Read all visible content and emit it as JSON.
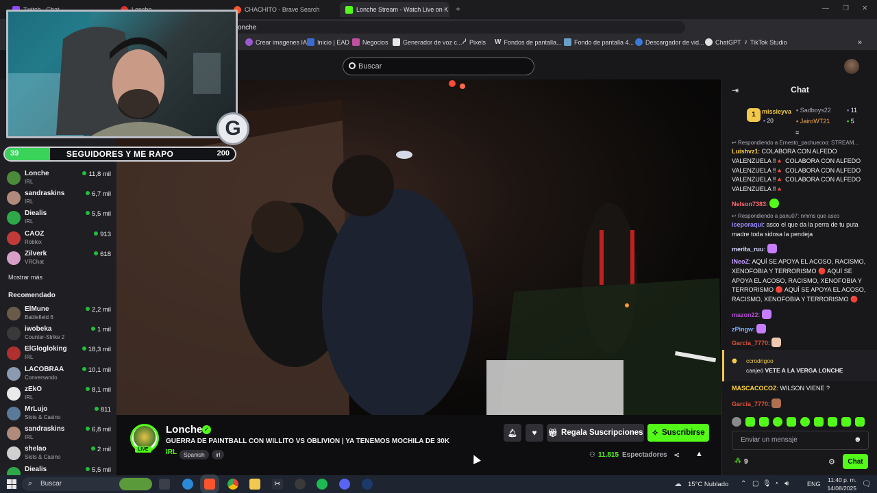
{
  "browser": {
    "tabs": [
      {
        "label": "Twitch · Chat"
      },
      {
        "label": "Lonche"
      },
      {
        "label": "CHACHITO - Brave Search"
      },
      {
        "label": "Lonche Stream - Watch Live on K"
      }
    ],
    "new_tab": "+",
    "url_text": "onche",
    "bookmarks": [
      {
        "label": "Crear imagenes IA"
      },
      {
        "label": "Inicio | EAD"
      },
      {
        "label": "Negocios"
      },
      {
        "label": "Generador de voz c..."
      },
      {
        "label": "Pixels"
      },
      {
        "label": "Fondos de pantalla..."
      },
      {
        "label": "Fondo de pantalla 4..."
      },
      {
        "label": "Descargador de vid..."
      },
      {
        "label": "ChatGPT"
      },
      {
        "label": "TikTok Studio"
      }
    ],
    "bookmarks_more": "»"
  },
  "site": {
    "search_placeholder": "Buscar"
  },
  "overlay": {
    "followers_current": "39",
    "followers_goal_text": "SEGUIDORES Y ME RAPO",
    "followers_target": "200",
    "followers_progress": 0.195,
    "logo_letter": "G"
  },
  "sidebar": {
    "followed": [
      {
        "name": "Lonche",
        "category": "IRL",
        "viewers": "11,8 mil",
        "color": "#4a8a3a",
        "live_color": "green"
      },
      {
        "name": "sandraskins",
        "category": "IRL",
        "viewers": "6,7 mil",
        "color": "#b08a7a",
        "live_color": "green"
      },
      {
        "name": "Diealis",
        "category": "IRL",
        "viewers": "5,5 mil",
        "color": "#2fa84a",
        "live_color": "green"
      },
      {
        "name": "CAOZ",
        "category": "Roblox",
        "viewers": "913",
        "color": "#c23a3a",
        "live_color": "green"
      },
      {
        "name": "Zilverk",
        "category": "VRChat",
        "viewers": "618",
        "color": "#d8a0c8",
        "live_color": "green"
      }
    ],
    "show_more": "Mostrar más",
    "recommended_title": "Recomendado",
    "recommended": [
      {
        "name": "ElMune",
        "category": "Battlefield 6",
        "viewers": "2,2 mil",
        "color": "#6a5a4a"
      },
      {
        "name": "iwobeka",
        "category": "Counter-Strike 2",
        "viewers": "1 mil",
        "color": "#3a3a3a"
      },
      {
        "name": "ElGlogloking",
        "category": "IRL",
        "viewers": "18,3 mil",
        "color": "#b03030"
      },
      {
        "name": "LACOBRAA",
        "category": "Conversando",
        "viewers": "10,1 mil",
        "color": "#8a9ab0"
      },
      {
        "name": "zEkO",
        "category": "IRL",
        "viewers": "8,1 mil",
        "color": "#eaeaea"
      },
      {
        "name": "MrLujo",
        "category": "Slots & Casino",
        "viewers": "811",
        "color": "#5a7a9a"
      },
      {
        "name": "sandraskins",
        "category": "IRL",
        "viewers": "6,8 mil",
        "color": "#b08a7a"
      },
      {
        "name": "shelao",
        "category": "Slots & Casino",
        "viewers": "2 mil",
        "color": "#d0d0d0"
      },
      {
        "name": "Diealis",
        "category": "IRL",
        "viewers": "5,5 mil",
        "color": "#2fa84a"
      }
    ]
  },
  "stream": {
    "channel": "Lonche",
    "live_label": "LIVE",
    "title": "GUERRA DE PAINTBALL CON WILLITO VS OBLIVION | YA TENEMOS MOCHILA DE 30K",
    "category": "IRL",
    "tags": [
      "Spanish",
      "irl"
    ],
    "gift_button": "Regala Suscripciones",
    "subscribe_button": "Suscribirse",
    "viewers": "11.815",
    "viewers_label": "Espectadores"
  },
  "chat": {
    "title": "Chat",
    "leaderboard": [
      {
        "rank": "1",
        "name": "missleyva",
        "count": "20"
      },
      {
        "rank": "",
        "name": "Sadboys22",
        "count": "11"
      },
      {
        "rank": "",
        "name": "JairoWT21",
        "count": "5"
      }
    ],
    "messages": [
      {
        "reply": "Respondiendo a Ernesto_pachuecoo: STREAM...",
        "user": "Luishvz1",
        "color": "#f2c94c",
        "text": "COLABORA CON ALFEDO VALENZUELA ‼🔺 COLABORA CON ALFEDO VALENZUELA ‼🔺 COLABORA CON ALFEDO VALENZUELA ‼🔺 COLABORA CON ALFEDO VALENZUELA ‼🔺"
      },
      {
        "user": "Nelson7383",
        "color": "#ff6b6b",
        "text": ""
      },
      {
        "reply": "Respondiendo a panu07: nmms que asco",
        "user": "iceporaqui",
        "color": "#9b8cff",
        "text": "asco el que da la perra de tu puta madre toda sidosa la pendeja"
      },
      {
        "user": "merita_ruu",
        "color": "#d6d6ff",
        "text": ""
      },
      {
        "user": "INeoZ",
        "color": "#c49bff",
        "text": "AQUÍ SE APOYA EL ACOSO, RACISMO, XENOFOBIA Y TERRORISMO 🔴 AQUÍ SE APOYA EL ACOSO, RACISMO, XENOFOBIA Y TERRORISMO 🔴 AQUÍ SE APOYA EL ACOSO, RACISMO, XENOFOBIA Y TERRORISMO 🔴"
      },
      {
        "user": "mazon22",
        "color": "#b04fd0",
        "text": ""
      },
      {
        "user": "zPingw",
        "color": "#7fb0ff",
        "text": ""
      },
      {
        "user": "Garcia_7770",
        "color": "#e0523a",
        "text": ""
      }
    ],
    "redeem": {
      "user": "ccrodrigoo",
      "action": "canjeó",
      "reward": "VETE A LA VERGA LONCHE"
    },
    "after": [
      {
        "user": "MASCACOCOZ",
        "color": "#ffd23a",
        "text": "WILSON VIENE ?"
      },
      {
        "user": "Garcia_7770",
        "color": "#e0523a",
        "text": ""
      }
    ],
    "input_placeholder": "Enviar un mensaje",
    "points": "9",
    "send_button": "Chat"
  },
  "taskbar": {
    "search_placeholder": "Buscar",
    "weather": "15°C  Nublado",
    "language": "ENG",
    "time": "11:40 p. m.",
    "date": "14/08/2025"
  }
}
